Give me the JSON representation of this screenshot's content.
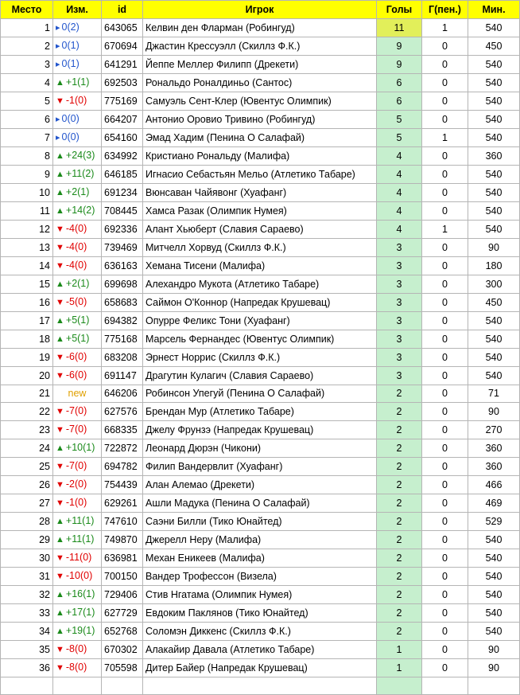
{
  "headers": {
    "place": "Место",
    "change": "Изм.",
    "id": "id",
    "player": "Игрок",
    "goals": "Голы",
    "penalties": "Г(пен.)",
    "minutes": "Мин."
  },
  "colors": {
    "header_bg": "#ffff00",
    "goals_bg": "#c6efce",
    "goals_top_bg": "#e2ef5a",
    "up": "#1a8a1a",
    "down": "#e00000",
    "same": "#2255cc",
    "new": "#e0a000"
  },
  "rows": [
    {
      "place": "1",
      "dir": "same",
      "change": "0(2)",
      "id": "643065",
      "player": "Келвин ден Фларман (Робингуд)",
      "goals": "11",
      "pen": "1",
      "min": "540"
    },
    {
      "place": "2",
      "dir": "same",
      "change": "0(1)",
      "id": "670694",
      "player": "Джастин Крессуэлл (Скиллз Ф.К.)",
      "goals": "9",
      "pen": "0",
      "min": "450"
    },
    {
      "place": "3",
      "dir": "same",
      "change": "0(1)",
      "id": "641291",
      "player": "Йеппе Меллер Филипп (Дрекети)",
      "goals": "9",
      "pen": "0",
      "min": "540"
    },
    {
      "place": "4",
      "dir": "up",
      "change": "+1(1)",
      "id": "692503",
      "player": "Рональдо Роналдиньо (Сантос)",
      "goals": "6",
      "pen": "0",
      "min": "540"
    },
    {
      "place": "5",
      "dir": "down",
      "change": "-1(0)",
      "id": "775169",
      "player": "Самуэль Сент-Клер (Ювентус Олимпик)",
      "goals": "6",
      "pen": "0",
      "min": "540"
    },
    {
      "place": "6",
      "dir": "same",
      "change": "0(0)",
      "id": "664207",
      "player": "Антонио Оровио Тривино (Робингуд)",
      "goals": "5",
      "pen": "0",
      "min": "540"
    },
    {
      "place": "7",
      "dir": "same",
      "change": "0(0)",
      "id": "654160",
      "player": "Эмад Хадим (Пенина О Салафай)",
      "goals": "5",
      "pen": "1",
      "min": "540"
    },
    {
      "place": "8",
      "dir": "up",
      "change": "+24(3)",
      "id": "634992",
      "player": "Кристиано Рональду (Малифа)",
      "goals": "4",
      "pen": "0",
      "min": "360"
    },
    {
      "place": "9",
      "dir": "up",
      "change": "+11(2)",
      "id": "646185",
      "player": "Игнасио Себастьян Мельо (Атлетико Табаре)",
      "goals": "4",
      "pen": "0",
      "min": "540"
    },
    {
      "place": "10",
      "dir": "up",
      "change": "+2(1)",
      "id": "691234",
      "player": "Вюнсаван Чайявонг (Хуафанг)",
      "goals": "4",
      "pen": "0",
      "min": "540"
    },
    {
      "place": "11",
      "dir": "up",
      "change": "+14(2)",
      "id": "708445",
      "player": "Хамса Разак (Олимпик Нумея)",
      "goals": "4",
      "pen": "0",
      "min": "540"
    },
    {
      "place": "12",
      "dir": "down",
      "change": "-4(0)",
      "id": "692336",
      "player": "Алант Хьюберт (Славия Сараево)",
      "goals": "4",
      "pen": "1",
      "min": "540"
    },
    {
      "place": "13",
      "dir": "down",
      "change": "-4(0)",
      "id": "739469",
      "player": "Митчелл Хорвуд (Скиллз Ф.К.)",
      "goals": "3",
      "pen": "0",
      "min": "90"
    },
    {
      "place": "14",
      "dir": "down",
      "change": "-4(0)",
      "id": "636163",
      "player": "Хемана Тисени (Малифа)",
      "goals": "3",
      "pen": "0",
      "min": "180"
    },
    {
      "place": "15",
      "dir": "up",
      "change": "+2(1)",
      "id": "699698",
      "player": "Алехандро Мукота (Атлетико Табаре)",
      "goals": "3",
      "pen": "0",
      "min": "300"
    },
    {
      "place": "16",
      "dir": "down",
      "change": "-5(0)",
      "id": "658683",
      "player": "Саймон О'Коннор (Напредак Крушевац)",
      "goals": "3",
      "pen": "0",
      "min": "450"
    },
    {
      "place": "17",
      "dir": "up",
      "change": "+5(1)",
      "id": "694382",
      "player": "Опурре Феликс Тони (Хуафанг)",
      "goals": "3",
      "pen": "0",
      "min": "540"
    },
    {
      "place": "18",
      "dir": "up",
      "change": "+5(1)",
      "id": "775168",
      "player": "Марсель Фернандес (Ювентус Олимпик)",
      "goals": "3",
      "pen": "0",
      "min": "540"
    },
    {
      "place": "19",
      "dir": "down",
      "change": "-6(0)",
      "id": "683208",
      "player": "Эрнест Норрис (Скиллз Ф.К.)",
      "goals": "3",
      "pen": "0",
      "min": "540"
    },
    {
      "place": "20",
      "dir": "down",
      "change": "-6(0)",
      "id": "691147",
      "player": "Драгутин Кулагич (Славия Сараево)",
      "goals": "3",
      "pen": "0",
      "min": "540"
    },
    {
      "place": "21",
      "dir": "new",
      "change": "new",
      "id": "646206",
      "player": "Робинсон Упегуй (Пенина О Салафай)",
      "goals": "2",
      "pen": "0",
      "min": "71"
    },
    {
      "place": "22",
      "dir": "down",
      "change": "-7(0)",
      "id": "627576",
      "player": "Брендан Мур (Атлетико Табаре)",
      "goals": "2",
      "pen": "0",
      "min": "90"
    },
    {
      "place": "23",
      "dir": "down",
      "change": "-7(0)",
      "id": "668335",
      "player": "Джелу Фрунзэ (Напредак Крушевац)",
      "goals": "2",
      "pen": "0",
      "min": "270"
    },
    {
      "place": "24",
      "dir": "up",
      "change": "+10(1)",
      "id": "722872",
      "player": "Леонард Дюрэн (Чикони)",
      "goals": "2",
      "pen": "0",
      "min": "360"
    },
    {
      "place": "25",
      "dir": "down",
      "change": "-7(0)",
      "id": "694782",
      "player": "Филип Вандервлит (Хуафанг)",
      "goals": "2",
      "pen": "0",
      "min": "360"
    },
    {
      "place": "26",
      "dir": "down",
      "change": "-2(0)",
      "id": "754439",
      "player": "Алан Алемао (Дрекети)",
      "goals": "2",
      "pen": "0",
      "min": "466"
    },
    {
      "place": "27",
      "dir": "down",
      "change": "-1(0)",
      "id": "629261",
      "player": "Ашли Мадука (Пенина О Салафай)",
      "goals": "2",
      "pen": "0",
      "min": "469"
    },
    {
      "place": "28",
      "dir": "up",
      "change": "+11(1)",
      "id": "747610",
      "player": "Саэни Билли (Тико Юнайтед)",
      "goals": "2",
      "pen": "0",
      "min": "529"
    },
    {
      "place": "29",
      "dir": "up",
      "change": "+11(1)",
      "id": "749870",
      "player": "Джерелл Неру (Малифа)",
      "goals": "2",
      "pen": "0",
      "min": "540"
    },
    {
      "place": "30",
      "dir": "down",
      "change": "-11(0)",
      "id": "636981",
      "player": "Механ Еникеев (Малифа)",
      "goals": "2",
      "pen": "0",
      "min": "540"
    },
    {
      "place": "31",
      "dir": "down",
      "change": "-10(0)",
      "id": "700150",
      "player": "Вандер Трофессон (Визела)",
      "goals": "2",
      "pen": "0",
      "min": "540"
    },
    {
      "place": "32",
      "dir": "up",
      "change": "+16(1)",
      "id": "729406",
      "player": "Стив Нгатама (Олимпик Нумея)",
      "goals": "2",
      "pen": "0",
      "min": "540"
    },
    {
      "place": "33",
      "dir": "up",
      "change": "+17(1)",
      "id": "627729",
      "player": "Евдоким Паклянов (Тико Юнайтед)",
      "goals": "2",
      "pen": "0",
      "min": "540"
    },
    {
      "place": "34",
      "dir": "up",
      "change": "+19(1)",
      "id": "652768",
      "player": "Соломэн Диккенс (Скиллз Ф.К.)",
      "goals": "2",
      "pen": "0",
      "min": "540"
    },
    {
      "place": "35",
      "dir": "down",
      "change": "-8(0)",
      "id": "670302",
      "player": "Алакайир Давала (Атлетико Табаре)",
      "goals": "1",
      "pen": "0",
      "min": "90"
    },
    {
      "place": "36",
      "dir": "down",
      "change": "-8(0)",
      "id": "705598",
      "player": "Дитер Байер (Напредак Крушевац)",
      "goals": "1",
      "pen": "0",
      "min": "90"
    }
  ]
}
